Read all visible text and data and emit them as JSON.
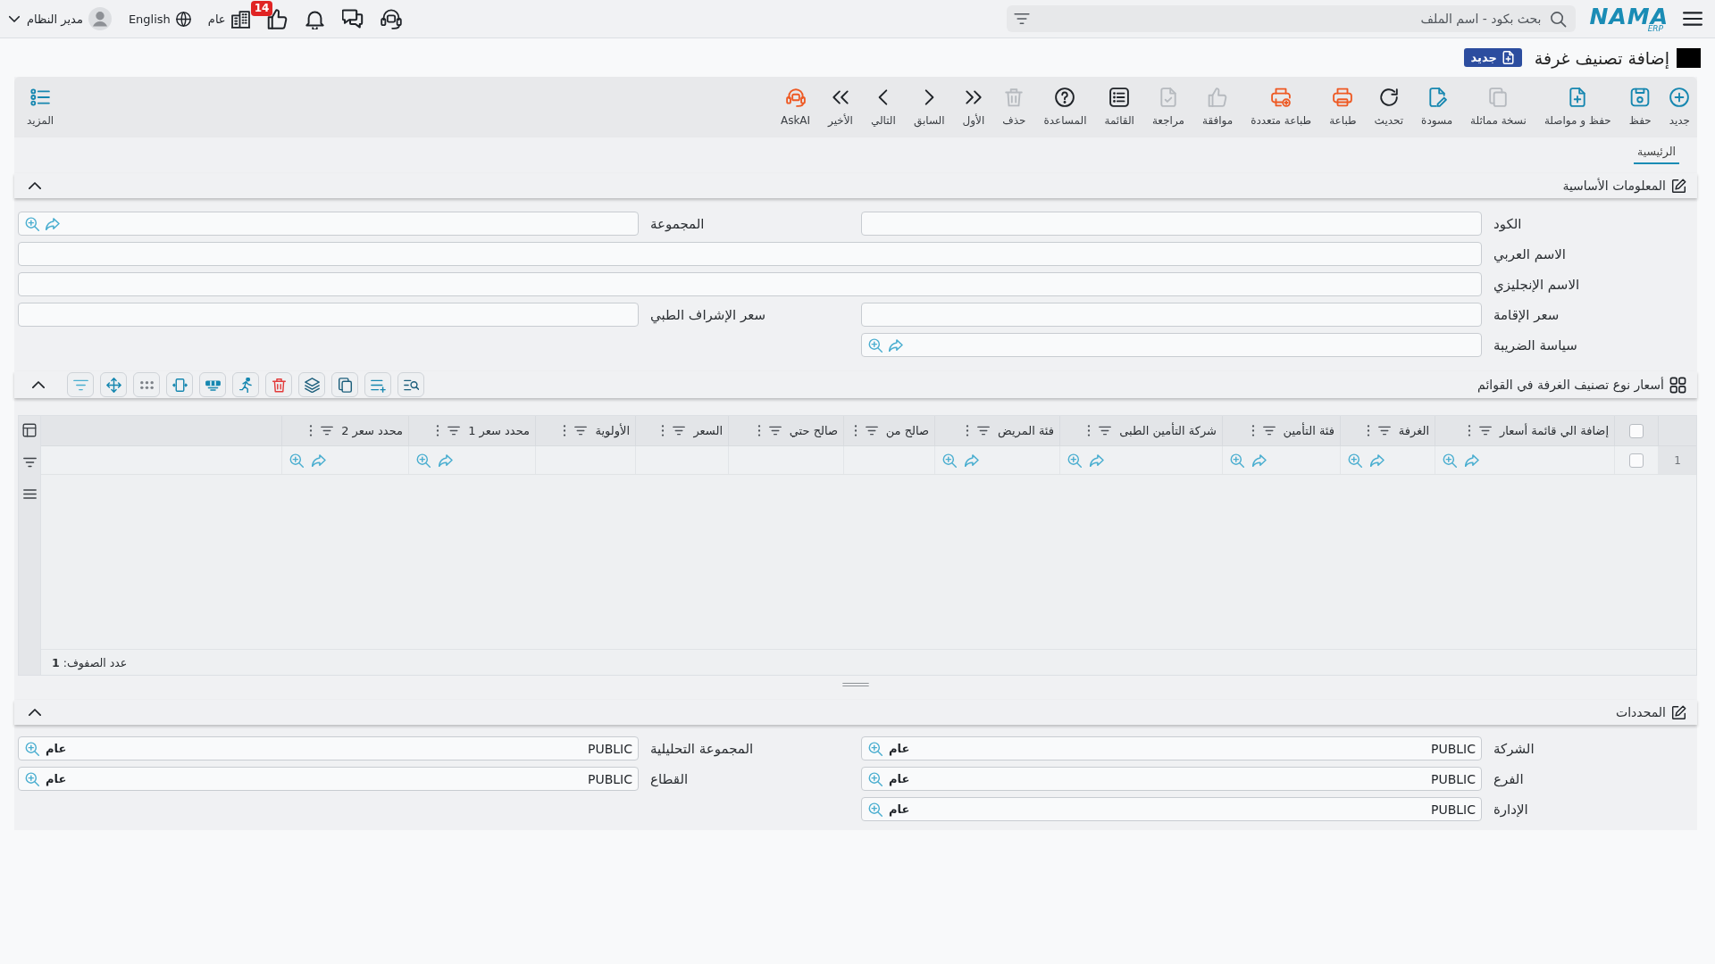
{
  "top_bar": {
    "logo": {
      "text": "NAMA",
      "subtext": "ERP"
    },
    "search": {
      "placeholder": "بحث بكود - اسم الملف"
    },
    "notifications": {
      "count": "14"
    },
    "company": "عام",
    "language": "English",
    "user": "مدير النظام"
  },
  "page": {
    "title": "إضافة تصنيف غرفة",
    "status": "جديد"
  },
  "toolbar": {
    "actions": [
      {
        "label": "جديد",
        "disabled": false
      },
      {
        "label": "حفظ",
        "disabled": false
      },
      {
        "label": "حفظ و مواصلة",
        "disabled": false
      },
      {
        "label": "نسخة مماثلة",
        "disabled": true
      },
      {
        "label": "مسودة",
        "disabled": false
      },
      {
        "label": "تحديث",
        "disabled": false
      },
      {
        "label": "طباعة",
        "disabled": false
      },
      {
        "label": "طباعة متعددة",
        "disabled": false
      },
      {
        "label": "موافقة",
        "disabled": true
      },
      {
        "label": "مراجعة",
        "disabled": true
      },
      {
        "label": "القائمة",
        "disabled": false
      },
      {
        "label": "المساعدة",
        "disabled": false
      },
      {
        "label": "حذف",
        "disabled": true
      },
      {
        "label": "الأول",
        "disabled": false
      },
      {
        "label": "السابق",
        "disabled": false
      },
      {
        "label": "التالي",
        "disabled": false
      },
      {
        "label": "الأخير",
        "disabled": false
      },
      {
        "label": "AskAI",
        "disabled": false
      }
    ],
    "more": "المزيد"
  },
  "tabs": [
    {
      "label": "الرئيسية",
      "selected": true
    }
  ],
  "basic_info": {
    "title": "المعلومات الأساسية",
    "expanded": true,
    "fields": [
      {
        "label": "الكود",
        "kind": "text"
      },
      {
        "label": "المجموعة",
        "kind": "lookup"
      },
      {
        "label": "الاسم العربي",
        "kind": "wide"
      },
      {
        "label": "الاسم الإنجليزي",
        "kind": "wide"
      },
      {
        "label": "سعر الإقامة",
        "kind": "text"
      },
      {
        "label": "سعر الإشراف الطبي",
        "kind": "text"
      },
      {
        "label": "سياسة الضريبة",
        "kind": "lookup"
      }
    ]
  },
  "price_lists": {
    "title": "أسعار نوع تصنيف الغرفة في القوائم",
    "expanded": true,
    "all_checked": false,
    "columns": [
      {
        "label": "إضافة الي قائمة أسعار",
        "kind": "lookup"
      },
      {
        "label": "الغرفة",
        "kind": "lookup"
      },
      {
        "label": "فئة التأمين",
        "kind": "lookup"
      },
      {
        "label": "شركة التأمين الطبى",
        "kind": "lookup"
      },
      {
        "label": "فئة المريض",
        "kind": "lookup"
      },
      {
        "label": "صالح من",
        "kind": "plain"
      },
      {
        "label": "صالح حتي",
        "kind": "plain"
      },
      {
        "label": "السعر",
        "kind": "plain"
      },
      {
        "label": "الأولوية",
        "kind": "plain"
      },
      {
        "label": "محدد سعر 1",
        "kind": "lookup"
      },
      {
        "label": "محدد سعر 2",
        "kind": "lookup"
      }
    ],
    "rows": [
      {
        "number": "1",
        "checked": false
      }
    ],
    "footer": "عدد الصفوف: **1**"
  },
  "dimensions": {
    "title": "المحددات",
    "expanded": true,
    "fields": [
      {
        "label": "الشركة",
        "value": "PUBLIC",
        "description": "عام"
      },
      {
        "label": "المجموعة التحليلية",
        "value": "PUBLIC",
        "description": "عام"
      },
      {
        "label": "الفرع",
        "value": "PUBLIC",
        "description": "عام"
      },
      {
        "label": "القطاع",
        "value": "PUBLIC",
        "description": "عام"
      },
      {
        "label": "الإدارة",
        "value": "PUBLIC",
        "description": "عام"
      }
    ]
  }
}
